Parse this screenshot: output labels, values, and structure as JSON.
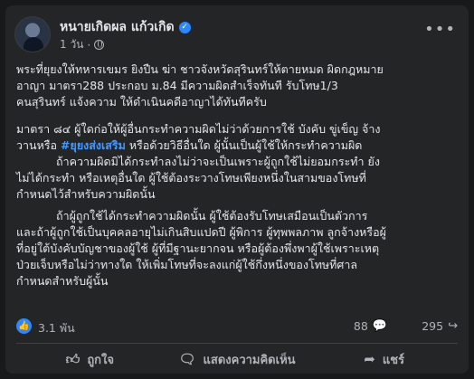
{
  "post": {
    "author": "หนายเกิดผล แก้วเกิด",
    "time": "1 วัน",
    "meta_sep": "·",
    "paragraphs": [
      {
        "lines": [
          "พระที่ยุยงให้ทหารเขมร ยิงปืน ฆ่า ชาวจังหวัดสุรินทร์ให้ตายหมด ผิดกฎหมาย",
          "อาญา มาตรา288 ประกอบ ม.84  มีความผิดสำเร็จทันที รับโทษ1/3",
          "คนสุรินทร์ แจ้งความ ให้ดำเนินคดีอาญาได้ทันทีครับ"
        ]
      }
    ],
    "section84": {
      "line1": "มาตรา ๘๔  ผู้ใดก่อให้ผู้อื่นกระทำความผิดไม่ว่าด้วยการใช้ บังคับ ขู่เข็ญ จ้าง",
      "line2_pre": "วานหรือ ",
      "hashtag": "#ยุยงส่งเสริม",
      "line2_post": " หรือด้วยวิธีอื่นใด ผู้นั้นเป็นผู้ใช้ให้กระทำความผิด",
      "para2": [
        "ถ้าความผิดมิได้กระทำลงไม่ว่าจะเป็นเพราะผู้ถูกใช้ไม่ยอมกระทำ ยัง",
        "ไม่ได้กระทำ หรือเหตุอื่นใด ผู้ใช้ต้องระวางโทษเพียงหนึ่งในสามของโทษที่",
        "กำหนดไว้สำหรับความผิดนั้น"
      ],
      "para3": [
        "ถ้าผู้ถูกใช้ได้กระทำความผิดนั้น ผู้ใช้ต้องรับโทษเสมือนเป็นตัวการ",
        "และถ้าผู้ถูกใช้เป็นบุคคลอายุไม่เกินสิบแปดปี ผู้พิการ ผู้ทุพพลภาพ ลูกจ้างหรือผู้",
        "ที่อยู่ใต้บังคับบัญชาของผู้ใช้ ผู้ที่มีฐานะยากจน หรือผู้ต้องพึ่งพาผู้ใช้เพราะเหตุ",
        "ป่วยเจ็บหรือไม่ว่าทางใด ให้เพิ่มโทษที่จะลงแก่ผู้ใช้กึ่งหนึ่งของโทษที่ศาล",
        "กำหนดสำหรับผู้นั้น"
      ]
    },
    "stats": {
      "reactions": "3.1 พัน",
      "comments": "88",
      "shares": "295"
    },
    "actions": {
      "like": "ถูกใจ",
      "comment": "แสดงความคิดเห็น",
      "share": "แชร์"
    },
    "icons": {
      "more": "more-icon",
      "verified": "verified-icon",
      "globe": "globe-icon",
      "like": "thumbs-up-icon",
      "comment": "comment-icon",
      "share": "share-icon"
    },
    "colors": {
      "background": "#242526",
      "accent": "#2d88ff",
      "hashtag": "#4599ff",
      "text": "#e4e6eb",
      "secondary": "#b0b3b8"
    }
  }
}
